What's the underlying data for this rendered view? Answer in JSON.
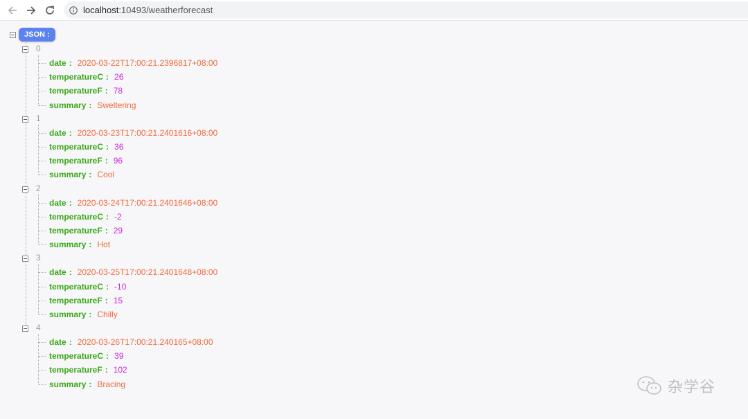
{
  "browser": {
    "url_host": "localhost",
    "url_rest": ":10493/weatherforecast",
    "icons": {
      "back": "arrow-left-icon",
      "forward": "arrow-right-icon",
      "reload": "reload-icon",
      "info": "info-icon"
    }
  },
  "viewer": {
    "root_label": "JSON :",
    "sep": ":",
    "items": [
      {
        "index": "0",
        "date_key": "date",
        "date": "2020-03-22T17:00:21.2396817+08:00",
        "tc_key": "temperatureC",
        "temperatureC": "26",
        "tf_key": "temperatureF",
        "temperatureF": "78",
        "summary_key": "summary",
        "summary": "Sweltering"
      },
      {
        "index": "1",
        "date_key": "date",
        "date": "2020-03-23T17:00:21.2401616+08:00",
        "tc_key": "temperatureC",
        "temperatureC": "36",
        "tf_key": "temperatureF",
        "temperatureF": "96",
        "summary_key": "summary",
        "summary": "Cool"
      },
      {
        "index": "2",
        "date_key": "date",
        "date": "2020-03-24T17:00:21.2401646+08:00",
        "tc_key": "temperatureC",
        "temperatureC": "-2",
        "tf_key": "temperatureF",
        "temperatureF": "29",
        "summary_key": "summary",
        "summary": "Hot"
      },
      {
        "index": "3",
        "date_key": "date",
        "date": "2020-03-25T17:00:21.2401648+08:00",
        "tc_key": "temperatureC",
        "temperatureC": "-10",
        "tf_key": "temperatureF",
        "temperatureF": "15",
        "summary_key": "summary",
        "summary": "Chilly"
      },
      {
        "index": "4",
        "date_key": "date",
        "date": "2020-03-26T17:00:21.240165+08:00",
        "tc_key": "temperatureC",
        "temperatureC": "39",
        "tf_key": "temperatureF",
        "temperatureF": "102",
        "summary_key": "summary",
        "summary": "Bracing"
      }
    ]
  },
  "watermark": {
    "text": "杂学谷",
    "icon": "wechat-icon"
  },
  "colors": {
    "key": "#3aa816",
    "string": "#f16a3b",
    "number": "#c72ad6",
    "root_badge": "#5b82ee"
  }
}
